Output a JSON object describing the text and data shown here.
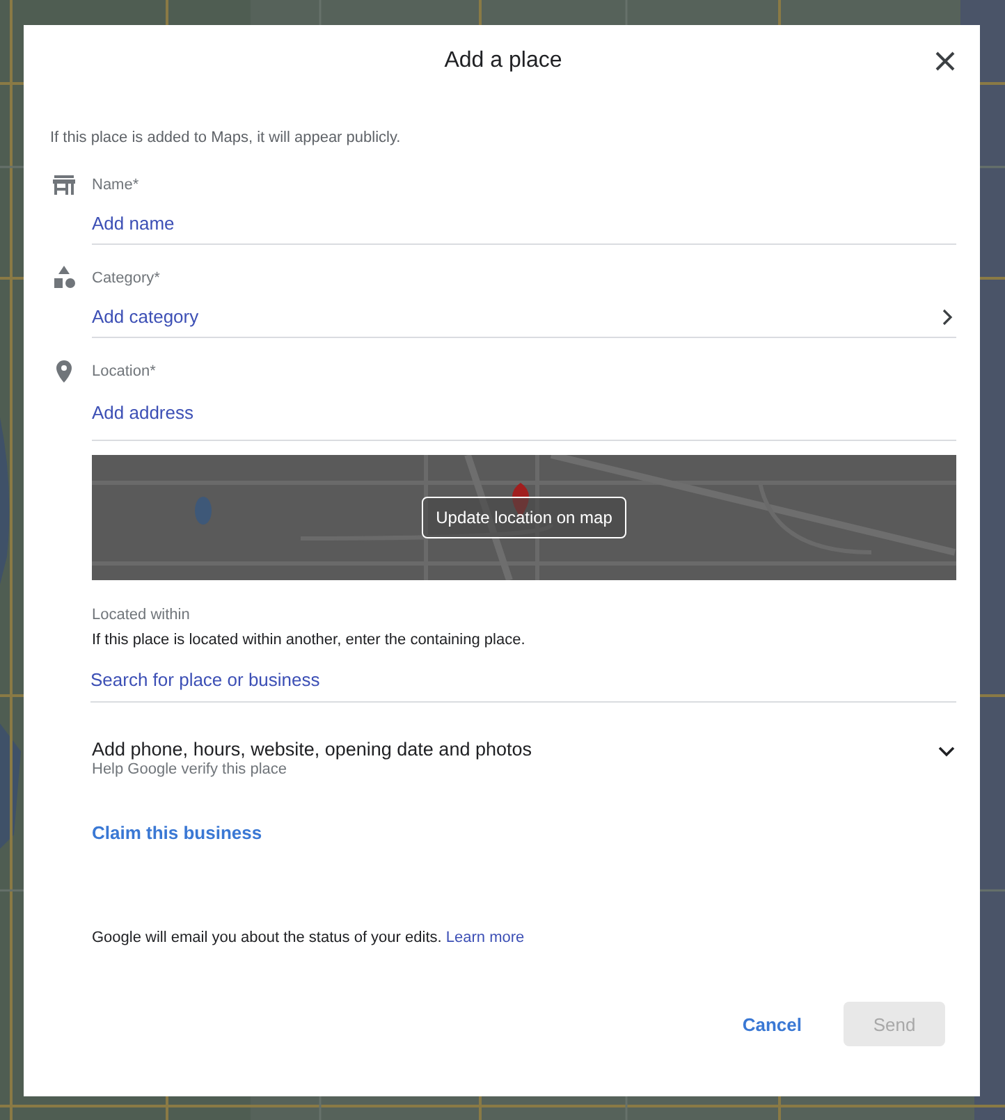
{
  "dialog": {
    "title": "Add a place",
    "intro": "If this place is added to Maps, it will appear publicly."
  },
  "fields": [
    {
      "label": "Name*",
      "placeholder": "Add name",
      "has_chevron": false
    },
    {
      "label": "Category*",
      "placeholder": "Add category",
      "has_chevron": true
    },
    {
      "label": "Location*",
      "placeholder": "Add address",
      "has_chevron": false
    }
  ],
  "map_preview": {
    "kind": "picture",
    "button": "Update location on map"
  },
  "located_within": {
    "label": "Located within",
    "description": "If this place is located within another, enter the containing place.",
    "placeholder": "Search for place or business"
  },
  "more_details": {
    "title": "Add phone, hours, website, opening date and photos",
    "subtitle": "Help Google verify this place",
    "expanded": false
  },
  "claim_link": "Claim this business",
  "footer_note": {
    "text": "Google will email you about the status of your edits.",
    "link": "Learn more"
  },
  "buttons": [
    {
      "label": "Cancel",
      "kind": "text",
      "disabled": false
    },
    {
      "label": "Send",
      "kind": "filled",
      "disabled": true
    }
  ]
}
